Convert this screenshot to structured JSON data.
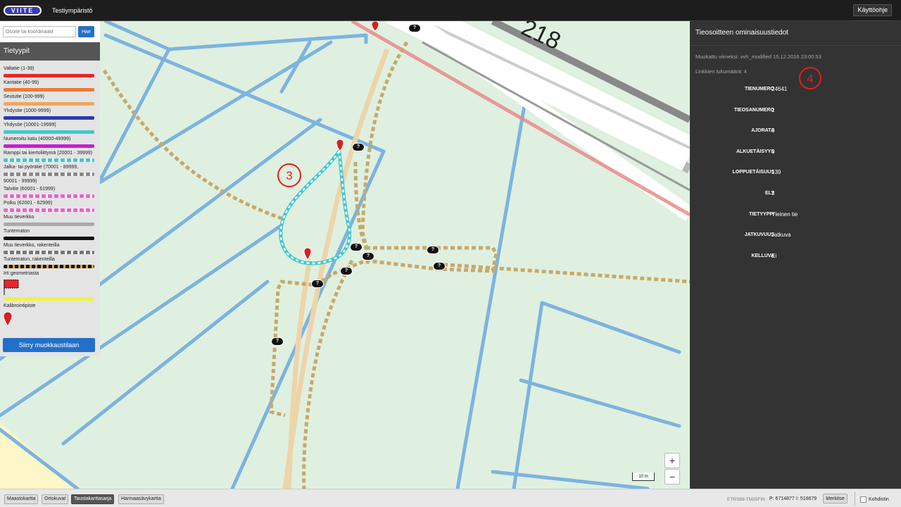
{
  "header": {
    "logo_text": "VIITE",
    "environment": "Testiympäristö",
    "help_label": "Käyttöohje"
  },
  "search": {
    "placeholder": "Osoite tai koordinaatit",
    "button_label": "Hae"
  },
  "legend": {
    "title": "Tietyypit",
    "items": [
      {
        "label": "Valtatie (1-39)",
        "color": "#e8262b",
        "style": "solid"
      },
      {
        "label": "Kantatie (40-99)",
        "color": "#ef7a33",
        "style": "solid"
      },
      {
        "label": "Seututie (100-999)",
        "color": "#f2a560",
        "style": "solid"
      },
      {
        "label": "Yhdystie (1000-9999)",
        "color": "#2a3bb0",
        "style": "solid"
      },
      {
        "label": "Yhdystie (10001-19999)",
        "color": "#40c8cf",
        "style": "solid"
      },
      {
        "label": "Numeroitu katu (40000-49999)",
        "color": "#c41fd3",
        "style": "solid"
      },
      {
        "label": "Ramppi tai kiertoliittymä (20001 - 39999)",
        "color": "#40c8cf",
        "style": "dashed"
      },
      {
        "label": "Jalka- tai pyörätie (70001 - 89999,",
        "color": "#888888",
        "style": "dashed"
      },
      {
        "label": "90001 - 99999)",
        "color": "",
        "style": "none"
      },
      {
        "label": "Talvitie (60001 - 61999)",
        "color": "#f05fd1",
        "style": "dashed"
      },
      {
        "label": "Polku (62001 - 62999)",
        "color": "#f05fd1",
        "style": "dashed"
      },
      {
        "label": "Muu tieverkko",
        "color": "#aaaaaa",
        "style": "solid"
      },
      {
        "label": "Tuntematon",
        "color": "#111111",
        "style": "solid"
      },
      {
        "label": "Muu tieverkko, rakenteilla",
        "color": "#777777",
        "style": "dashed"
      },
      {
        "label": "Tuntematon, rakenteilla",
        "color": "#111111",
        "style": "dashed-orange"
      },
      {
        "label": "Irti geometriasta",
        "color": "#e8262b",
        "style": "flag"
      },
      {
        "label": "",
        "color": "#f2f23a",
        "style": "solid"
      },
      {
        "label": "Kalibrointipiste",
        "color": "#d62020",
        "style": "pin"
      }
    ],
    "edit_button": "Siirry muokkaustilaan"
  },
  "map": {
    "road_number_label": "218",
    "annotation_3": "3",
    "annotation_4": "4",
    "scale_label": "10 m",
    "zoom_in": "+",
    "zoom_out": "−",
    "unknown_marker": "?"
  },
  "panel": {
    "title": "Tieosoitteen ominaisuustiedot",
    "modified": "Muokattu viimeksi: vvh_modified 15.12.2016 23:00:53",
    "link_count": "Linkkien lukumäärä: 4",
    "properties": [
      {
        "key": "TIENUMERO",
        "value": "24641"
      },
      {
        "key": "TIEOSANUMERO",
        "value": "1"
      },
      {
        "key": "AJORATA",
        "value": "0"
      },
      {
        "key": "ALKUETÄISYYS",
        "value": "0"
      },
      {
        "key": "LOPPUETÄISUUS",
        "value": "139"
      },
      {
        "key": "ELY",
        "value": "3"
      },
      {
        "key": "TIETYYPPI",
        "value": "Yleinen tie"
      },
      {
        "key": "JATKUVUUS",
        "value": "Jatkuva"
      },
      {
        "key": "KELLUVA",
        "value": "Ei"
      }
    ]
  },
  "footer": {
    "basemaps": [
      {
        "label": "Maastokartta",
        "active": false
      },
      {
        "label": "Ortokuvat",
        "active": false
      },
      {
        "label": "Taustakarttasarja",
        "active": true
      },
      {
        "label": "Harmaasävykartta",
        "active": false
      }
    ],
    "projection": "ETRS89-TM35FIN",
    "coord_p": "P: 6714877",
    "coord_i": "I: 516679",
    "mark_button": "Merkitse",
    "crosshair_label": "Kohdistin"
  }
}
